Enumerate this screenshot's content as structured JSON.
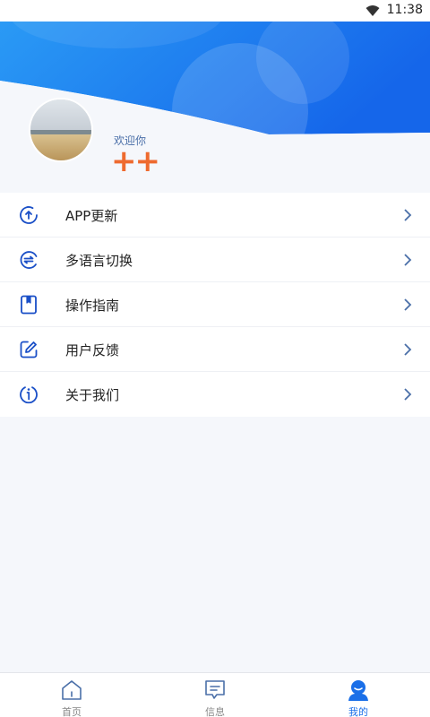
{
  "status_bar": {
    "time": "11:38"
  },
  "profile": {
    "welcome": "欢迎你",
    "nickname": "++"
  },
  "menu": [
    {
      "label": "APP更新",
      "icon": "upload-circle-icon"
    },
    {
      "label": "多语言切换",
      "icon": "language-switch-icon"
    },
    {
      "label": "操作指南",
      "icon": "guide-book-icon"
    },
    {
      "label": "用户反馈",
      "icon": "edit-feedback-icon"
    },
    {
      "label": "关于我们",
      "icon": "info-circle-icon"
    }
  ],
  "tabs": [
    {
      "label": "首页",
      "icon": "home-icon",
      "active": false
    },
    {
      "label": "信息",
      "icon": "message-icon",
      "active": false
    },
    {
      "label": "我的",
      "icon": "user-icon",
      "active": true
    }
  ],
  "colors": {
    "accent": "#1a6fe8",
    "nickname": "#ee6a2f",
    "header_blue": "#1f7cf0"
  }
}
